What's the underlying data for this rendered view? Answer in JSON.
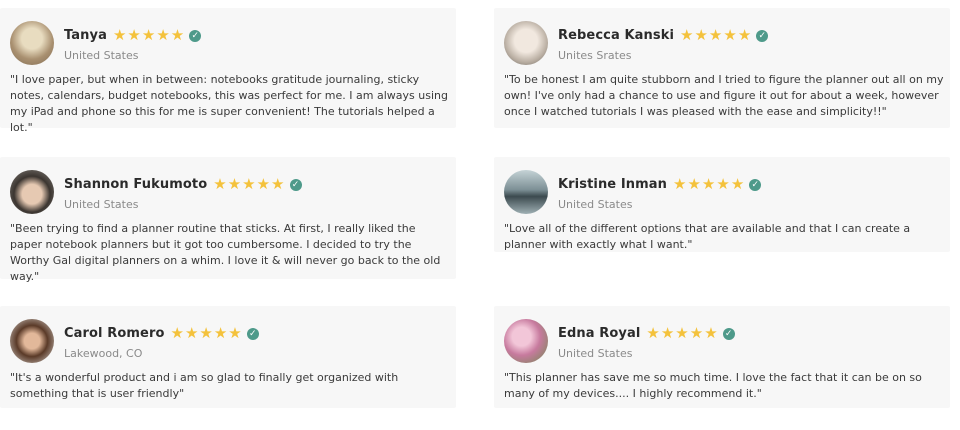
{
  "reviews": [
    {
      "name": "Tanya",
      "location": "United States",
      "quote": "\"I love paper, but when in between: notebooks gratitude journaling, sticky notes, calendars, budget notebooks, this was perfect for me. I am always using my iPad and phone so this for me is super convenient! The tutorials helped a lot.\"",
      "stars": 5,
      "avatar_color": "#c9b79a"
    },
    {
      "name": "Rebecca Kanski",
      "location": "Unites Srates",
      "quote": "\"To be honest I am quite stubborn and I tried to figure the planner out all on my own! I've only had a chance to use and figure it out for about a week, however once I watched tutorials I was  pleased with the ease and simplicity!!\"",
      "stars": 5,
      "avatar_color": "#d8cfc6"
    },
    {
      "name": "Shannon Fukumoto",
      "location": "United States",
      "quote": "\"Been trying to find a planner routine that sticks.  At first, I really liked the paper notebook planners but it got too cumbersome.  I decided to try the Worthy Gal digital planners on a whim. I love it & will never go back to the old way.\"",
      "stars": 5,
      "avatar_color": "#b9a89a"
    },
    {
      "name": "Kristine Inman",
      "location": "United States",
      "quote": "\"Love all of the different options that are available and that I can create a planner with exactly what I want.\"",
      "stars": 5,
      "avatar_color": "#7d8f94"
    },
    {
      "name": "Carol Romero",
      "location": "Lakewood, CO",
      "quote": "\"It's a wonderful product and i am so glad to finally get organized with something that is user friendly\"",
      "stars": 5,
      "avatar_color": "#8a6a55"
    },
    {
      "name": "Edna Royal",
      "location": "United States",
      "quote": "\"This planner has save me so much time. I love the fact that it can be on so many of my devices.... I highly recommend it.\"",
      "stars": 5,
      "avatar_color": "#d59ab5"
    }
  ],
  "star_glyph": "★",
  "verified_glyph": "✓",
  "colors": {
    "star": "#f4c23c",
    "verified": "#4e9a8a",
    "card_bg": "#f7f7f7"
  }
}
